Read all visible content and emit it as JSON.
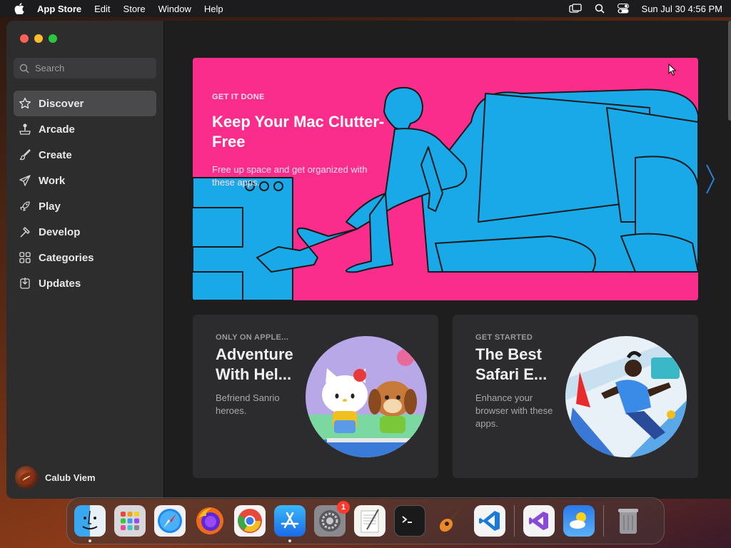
{
  "menubar": {
    "app_name": "App Store",
    "menus": [
      "Edit",
      "Store",
      "Window",
      "Help"
    ],
    "datetime": "Sun Jul 30  4:56 PM"
  },
  "search": {
    "placeholder": "Search"
  },
  "sidebar": {
    "items": [
      {
        "label": "Discover",
        "icon": "star-icon",
        "active": true
      },
      {
        "label": "Arcade",
        "icon": "joystick-icon"
      },
      {
        "label": "Create",
        "icon": "brush-icon"
      },
      {
        "label": "Work",
        "icon": "paper-plane-icon"
      },
      {
        "label": "Play",
        "icon": "rocket-icon"
      },
      {
        "label": "Develop",
        "icon": "hammer-icon"
      },
      {
        "label": "Categories",
        "icon": "grid-icon"
      },
      {
        "label": "Updates",
        "icon": "download-icon"
      }
    ],
    "user_name": "Calub Viem"
  },
  "hero": {
    "eyebrow": "GET IT DONE",
    "title": "Keep Your Mac Clutter-Free",
    "subtitle": "Free up space and get organized with these apps.",
    "background": "#fa2c8c",
    "art_color": "#19a8e8"
  },
  "cards": [
    {
      "eyebrow": "ONLY ON APPLE...",
      "title": "Adventure With Hel...",
      "description": "Befriend Sanrio heroes."
    },
    {
      "eyebrow": "GET STARTED",
      "title": "The Best Safari E...",
      "description": "Enhance your browser with these apps."
    }
  ],
  "dock": {
    "apps": [
      "Finder",
      "Launchpad",
      "Safari",
      "Firefox",
      "Chrome",
      "App Store",
      "System Settings",
      "TextEdit",
      "Terminal",
      "GarageBand",
      "VS Code",
      "Visual Studio",
      "Weather",
      "Trash"
    ],
    "settings_badge": "1"
  }
}
